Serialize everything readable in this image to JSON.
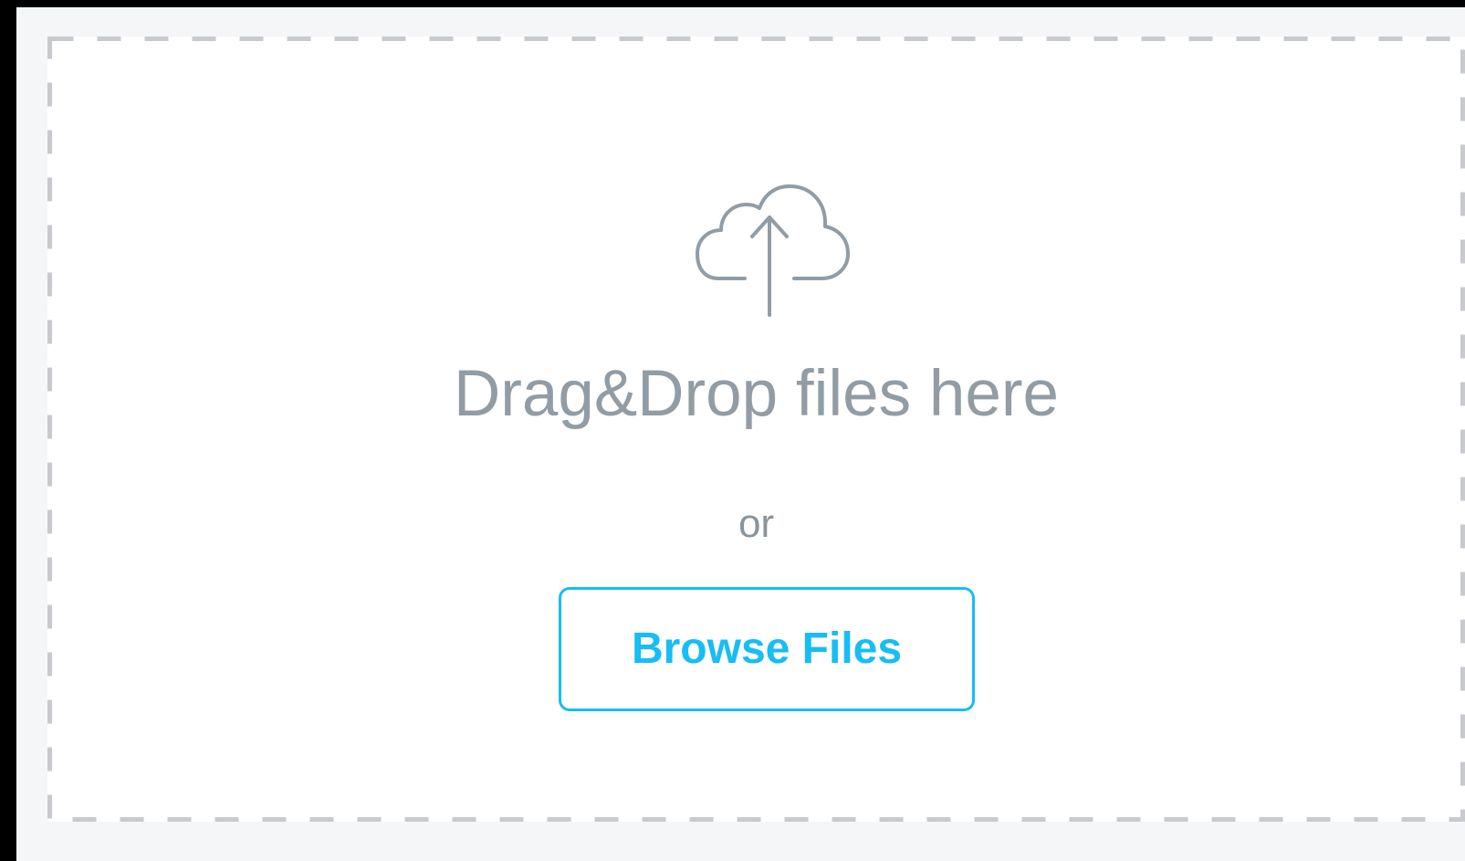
{
  "dropzone": {
    "title": "Drag&Drop files here",
    "or_text": "or",
    "browse_button_label": "Browse Files",
    "icon": "cloud-upload-icon"
  },
  "colors": {
    "border": "#c8cacd",
    "text": "#919ca4",
    "accent": "#17bdf3",
    "page_background": "#f5f6f8",
    "dropzone_background": "#ffffff"
  }
}
